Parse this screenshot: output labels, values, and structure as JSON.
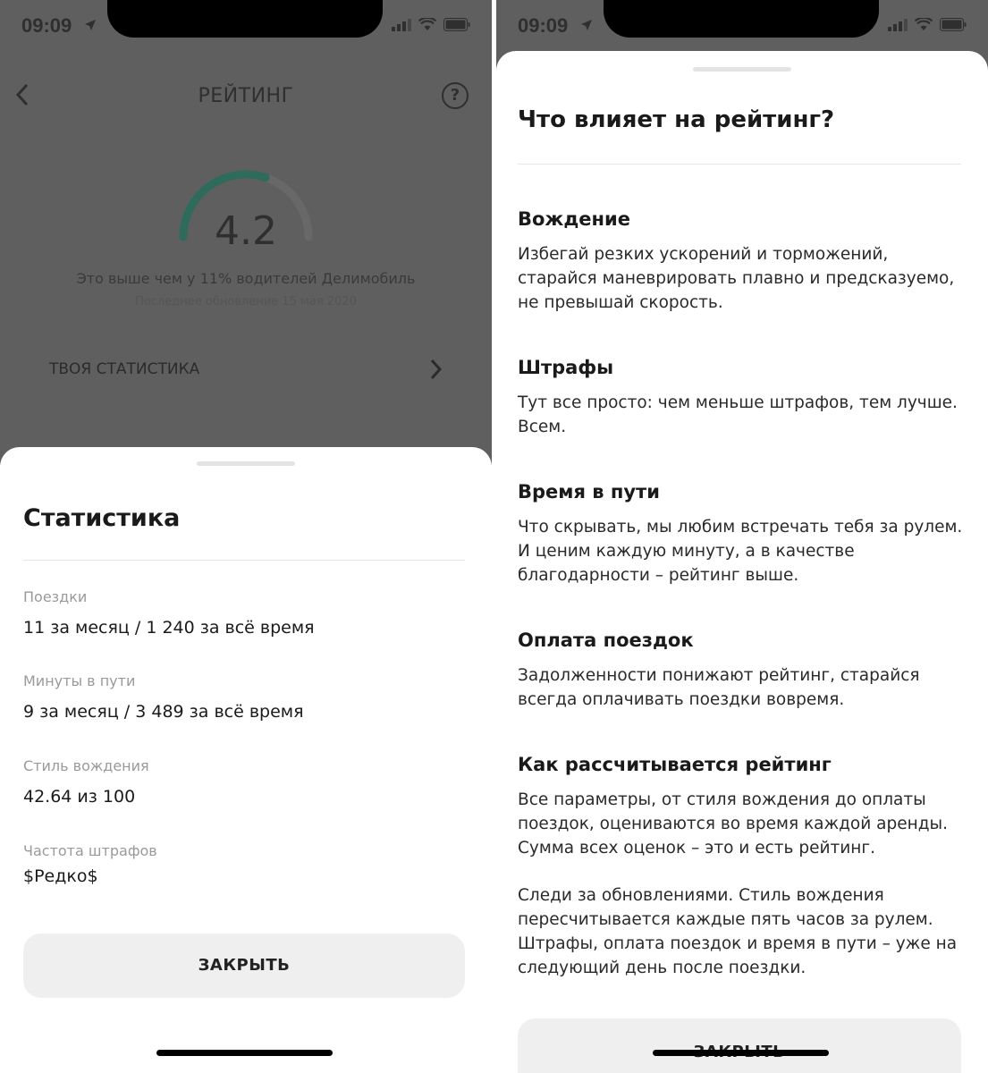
{
  "left_screen": {
    "status_time": "09:09",
    "header": {
      "title": "РЕЙТИНГ"
    },
    "rating": {
      "value": "4.2",
      "level": 0.6,
      "subtitle": "Это выше чем у 11% водителей Делимобиль",
      "updated": "Последнее обновление 15 мая 2020"
    },
    "stats_row_label": "ТВОЯ СТАТИСТИКА",
    "sheet": {
      "title": "Статистика",
      "items": [
        {
          "label": "Поездки",
          "value": "11 за месяц  /  1 240 за всё время"
        },
        {
          "label": "Минуты в пути",
          "value": "9 за месяц  /  3 489 за всё время"
        },
        {
          "label": "Стиль вождения",
          "value": "42.64 из 100"
        },
        {
          "label": "Частота штрафов",
          "value": "$Редко$"
        }
      ],
      "close_button": "ЗАКРЫТЬ"
    }
  },
  "right_screen": {
    "status_time": "09:09",
    "title": "Что влияет на рейтинг?",
    "sections": [
      {
        "heading": "Вождение",
        "text": "Избегай резких ускорений и торможений, старайся маневрировать плавно и предсказуемо, не превышай скорость."
      },
      {
        "heading": "Штрафы",
        "text": "Тут все просто: чем меньше штрафов, тем лучше. Всем."
      },
      {
        "heading": "Время в пути",
        "text": "Что скрывать, мы любим встречать тебя за рулем. И ценим каждую минуту, а в качестве благодарности – рейтинг выше."
      },
      {
        "heading": "Оплата поездок",
        "text": "Задолженности понижают рейтинг, старайся всегда оплачивать поездки вовремя."
      },
      {
        "heading": "Как рассчитывается рейтинг",
        "text": "Все параметры, от стиля вождения до оплаты поездок, оцениваются во время каждой аренды. Сумма всех оценок – это и есть рейтинг.",
        "text2": "Следи за обновлениями. Стиль вождения пересчитывается каждые пять часов за рулем. Штрафы, оплата поездок и время в пути – уже на следующий день после поездки."
      }
    ],
    "close_button": "ЗАКРЫТЬ"
  },
  "colors": {
    "gauge_accent": "#2f6b5a",
    "overlay": "#5f5f5f",
    "button_bg": "#efefef"
  },
  "icons": [
    "location-arrow-icon",
    "signal-icon",
    "wifi-icon",
    "battery-icon",
    "back-arrow-icon",
    "help-icon",
    "chevron-right-icon"
  ]
}
